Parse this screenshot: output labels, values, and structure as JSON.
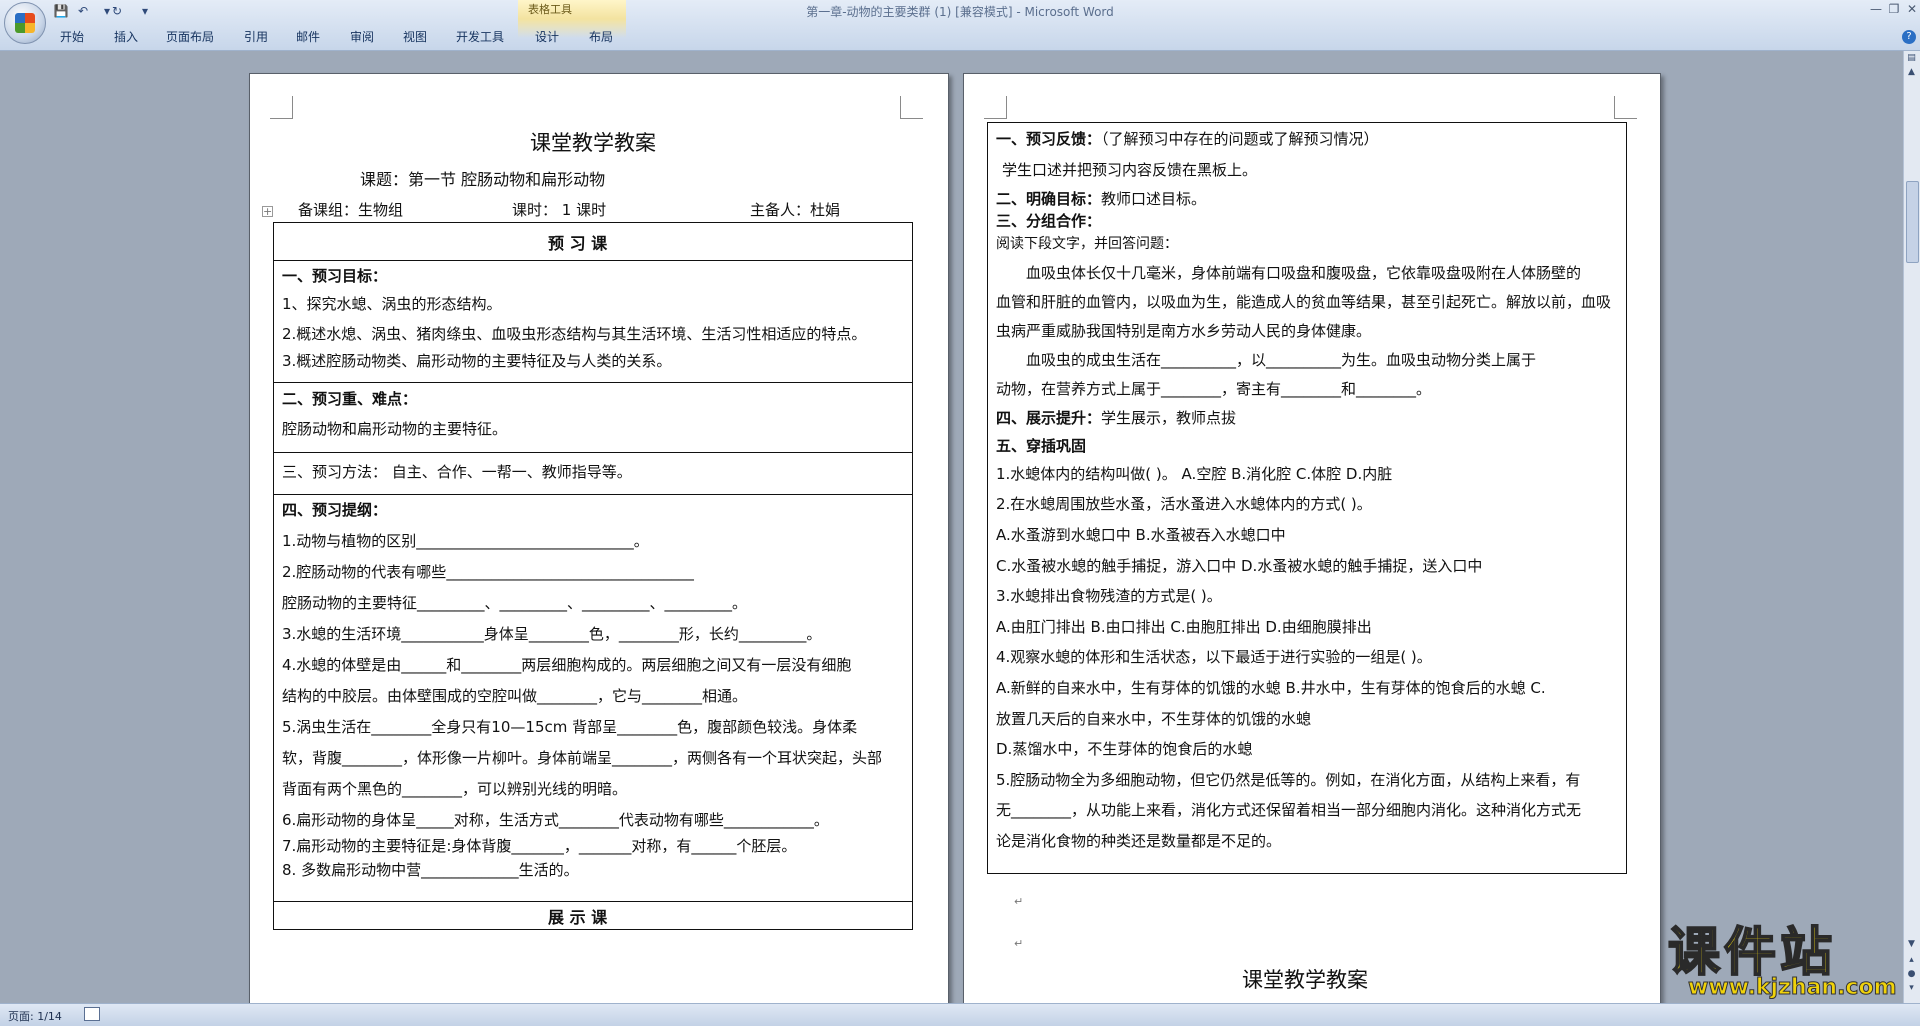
{
  "window": {
    "title": "第一章-动物的主要类群 (1) [兼容模式] - Microsoft Word",
    "context_group": "表格工具"
  },
  "ribbon": {
    "tabs": [
      "开始",
      "插入",
      "页面布局",
      "引用",
      "邮件",
      "审阅",
      "视图",
      "开发工具",
      "设计",
      "布局"
    ]
  },
  "status": {
    "page": "页面: 1/14"
  },
  "watermark": {
    "big": "课件站",
    "small": "www.kjzhan.com"
  },
  "page1": {
    "title": "课堂教学教案",
    "subtitle": "课题：第一节  腔肠动物和扁形动物",
    "meta_group": "备课组：生物组",
    "meta_hours": "课时：  1 课时",
    "meta_lead": "主备人：杜娟",
    "section_preview": "预  习  课",
    "goals_head": "一、预习目标：",
    "goals": [
      "1、探究水螅、涡虫的形态结构。",
      "2.概述水熄、涡虫、猪肉绦虫、血吸虫形态结构与其生活环境、生活习性相适应的特点。",
      "3.概述腔肠动物类、扁形动物的主要特征及与人类的关系。"
    ],
    "key_head": "二、预习重、难点：",
    "key_text": "腔肠动物和扁形动物的主要特征。",
    "method_text": "三、预习方法：   自主、合作、一帮一、教师指导等。",
    "outline_head": "四、预习提纲：",
    "outline": [
      "1.动物与植物的区别_____________________________。",
      "2.腔肠动物的代表有哪些_________________________________",
      " 腔肠动物的主要特征_________、_________、_________、_________。",
      "3.水螅的生活环境___________身体呈________色，________形，长约_________。",
      "4.水螅的体壁是由______和________两层细胞构成的。两层细胞之间又有一层没有细胞",
      "结构的中胶层。由体壁围成的空腔叫做________，它与________相通。",
      "5.涡虫生活在________全身只有10—15cm 背部呈________色，腹部颜色较浅。身体柔",
      "软，背腹________，体形像一片柳叶。身体前端呈________，两侧各有一个耳状突起，头部",
      "背面有两个黑色的________，可以辨别光线的明暗。",
      "6.扁形动物的身体呈_____对称，生活方式________代表动物有哪些____________。",
      "7.扁形动物的主要特征是:身体背腹_______，_______对称，有______个胚层。",
      "8. 多数扁形动物中营_____________生活的。"
    ],
    "section_show": "展  示  课"
  },
  "page2": {
    "fb_head": "一、预习反馈：",
    "fb_note": "（了解预习中存在的问题或了解预习情况）",
    "fb_text": "学生口述并把预习内容反馈在黑板上。",
    "aim_head": "二、明确目标：",
    "aim_text": "教师口述目标。",
    "coop_head": "三、分组合作：",
    "read_hint": "阅读下段文字，并回答问题：",
    "passage": [
      "血吸虫体长仅十几毫米，身体前端有口吸盘和腹吸盘，它依靠吸盘吸附在人体肠壁的",
      "血管和肝脏的血管内，以吸血为生，能造成人的贫血等结果，甚至引起死亡。解放以前，血吸",
      "虫病严重威胁我国特别是南方水乡劳动人民的身体健康。",
      "血吸虫的成虫生活在__________，以__________为生。血吸虫动物分类上属于",
      "动物，在营养方式上属于________，寄主有________和________。"
    ],
    "show_head": "四、展示提升：",
    "show_text": "学生展示，教师点拔",
    "drill_head": "五、穿插巩固",
    "drill": [
      "1.水螅体内的结构叫做(       )。  A.空腔   B.消化腔   C.体腔   D.内脏",
      "2.在水螅周围放些水蚤，活水蚤进入水螅体内的方式(        )。",
      "  A.水蚤游到水螅口中                  B.水蚤被吞入水螅口中",
      "  C.水蚤被水螅的触手捕捉，游入口中   D.水蚤被水螅的触手捕捉，送入口中",
      "3.水螅排出食物残渣的方式是(          )。",
      "  A.由肛门排出   B.由口排出     C.由胞肛排出   D.由细胞膜排出",
      "4.观察水螅的体形和生活状态，以下最适于进行实验的一组是(           )。",
      "A.新鲜的自来水中，生有芽体的饥饿的水螅      B.井水中，生有芽体的饱食后的水螅     C.",
      "放置几天后的自来水中，不生芽体的饥饿的水螅",
      "  D.蒸馏水中，不生芽体的饱食后的水螅",
      "5.腔肠动物全为多细胞动物，但它仍然是低等的。例如，在消化方面，从结构上来看，有",
      "无________，从功能上来看，消化方式还保留着相当一部分细胞内消化。这种消化方式无",
      "论是消化食物的种类还是数量都是不足的。"
    ],
    "next_title": "课堂教学教案"
  }
}
